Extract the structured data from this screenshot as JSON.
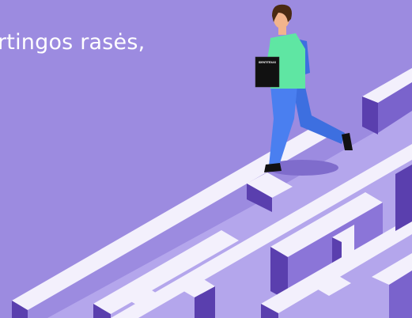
{
  "banner": {
    "headline": "rtingos rasės,",
    "book_label": "IDENTITEXAS"
  },
  "colors": {
    "background": "#9c8be0",
    "maze_top": "#f3f0fc",
    "maze_side": "#5a3fae",
    "maze_floor": "#b4a6ec",
    "headline_text": "#ffffff",
    "shirt": "#5fe6a3",
    "pants": "#3d6fe0",
    "hair": "#4a2a12",
    "skin": "#f2b48c",
    "book": "#111111"
  }
}
